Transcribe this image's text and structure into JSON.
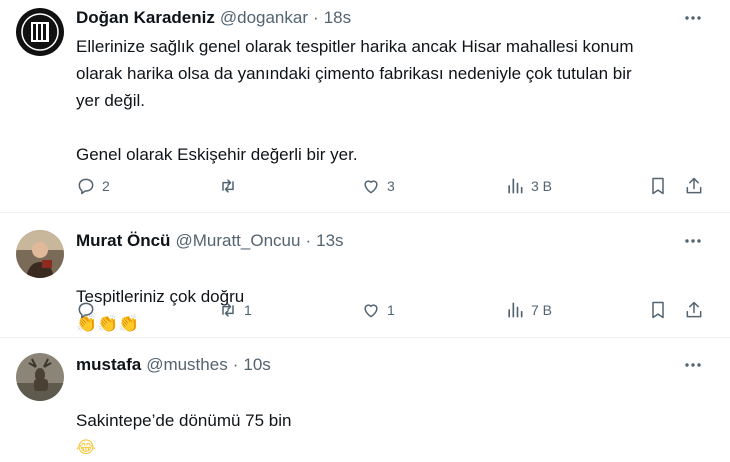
{
  "tweets": [
    {
      "name": "Doğan Karadeniz",
      "handle": "@dogankar",
      "time": "18s",
      "text": "Ellerinize sağlık genel olarak tespitler harika ancak Hisar mahallesi konum\nolarak harika olsa da yanındaki çimento fabrikası nedeniyle çok tutulan bir\nyer değil.\n\nGenel olarak Eskişehir değerli bir yer.",
      "replies": "2",
      "retweets": "",
      "likes": "3",
      "views": "3 B"
    },
    {
      "name": "Murat Öncü",
      "handle": "@Muratt_Oncuu",
      "time": "13s",
      "text": "Tespitleriniz çok doğru",
      "emoji": "👏👏👏",
      "replies": "",
      "retweets": "1",
      "likes": "1",
      "views": "7 B"
    },
    {
      "name": "mustafa",
      "handle": "@musthes",
      "time": "10s",
      "text": "Sakintepe’de dönümü 75 bin",
      "emoji": "😂"
    }
  ],
  "icons": {
    "reply": "reply-icon",
    "retweet": "retweet-icon",
    "like": "heart-icon",
    "views": "views-icon",
    "bookmark": "bookmark-icon",
    "share": "share-icon",
    "more": "more-icon"
  },
  "colors": {
    "text": "#0f1419",
    "secondary": "#536471",
    "divider": "#eff3f4",
    "clap": "#f4b400",
    "laugh": "#f7c948"
  }
}
